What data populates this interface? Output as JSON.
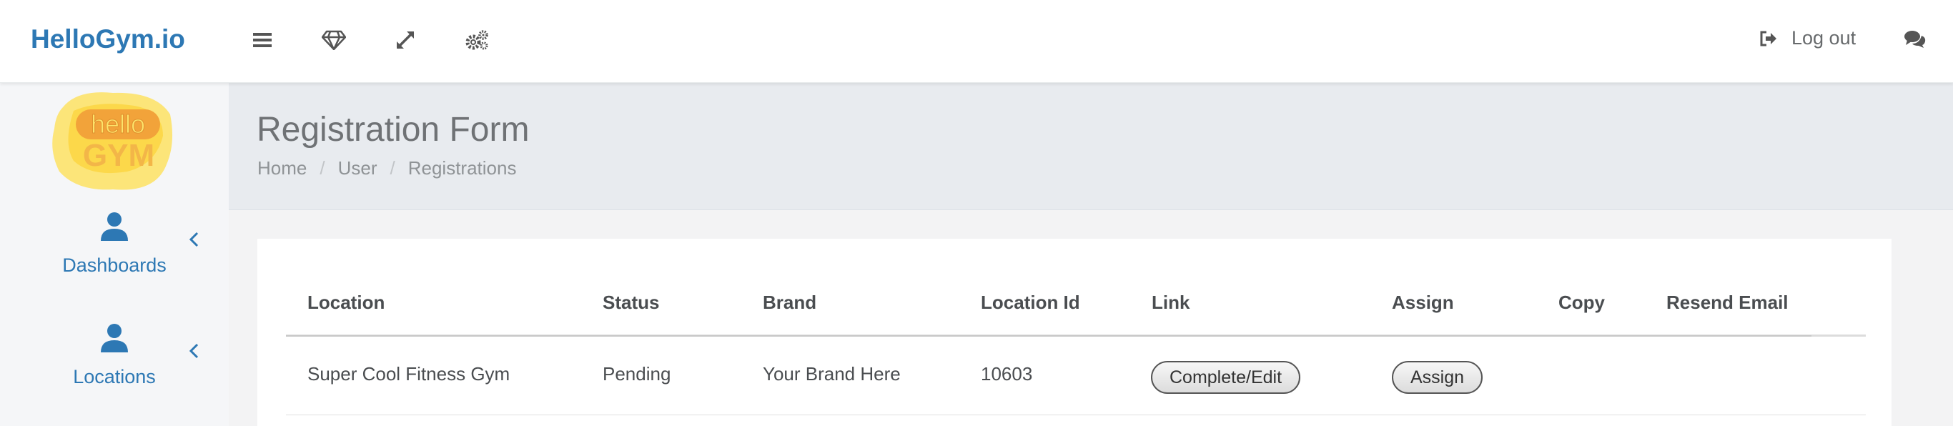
{
  "app": {
    "brand": "HelloGym.io",
    "logo_text_top": "hello",
    "logo_text_bottom": "GYM"
  },
  "topbar": {
    "icons": [
      "hamburger-icon",
      "diamond-icon",
      "expand-icon",
      "cogs-icon"
    ],
    "logout_label": "Log out",
    "chat_icon": "comments-icon"
  },
  "sidebar": {
    "items": [
      {
        "label": "Dashboards",
        "icon": "user-icon"
      },
      {
        "label": "Locations",
        "icon": "user-icon"
      }
    ]
  },
  "page": {
    "title": "Registration Form",
    "breadcrumb": [
      "Home",
      "User",
      "Registrations"
    ]
  },
  "table": {
    "columns": [
      "Location",
      "Status",
      "Brand",
      "Location Id",
      "Link",
      "Assign",
      "Copy",
      "Resend Email"
    ],
    "rows": [
      {
        "location": "Super Cool Fitness Gym",
        "status": "Pending",
        "brand": "Your Brand Here",
        "location_id": "10603",
        "link_button": "Complete/Edit",
        "assign_button": "Assign"
      }
    ]
  },
  "colors": {
    "brand_blue": "#2d78b4",
    "heading_bg": "#e8ebef",
    "sidebar_bg": "#f5f6f8"
  }
}
